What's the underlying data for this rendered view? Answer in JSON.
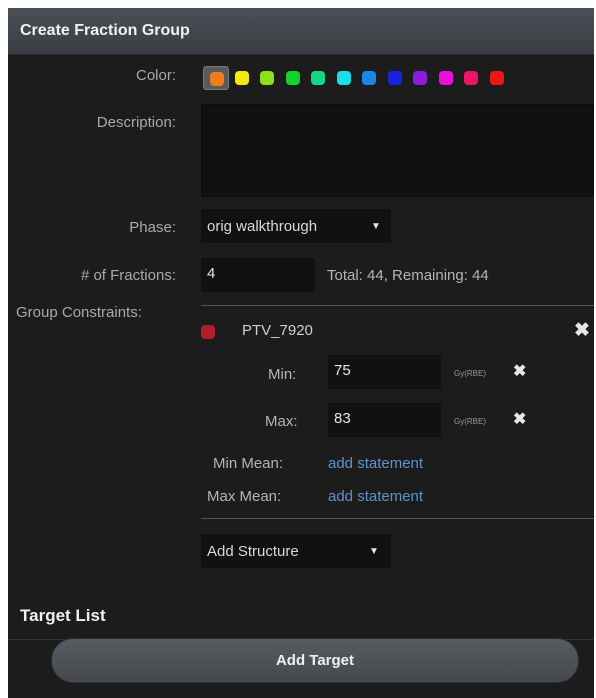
{
  "header": {
    "title": "Create Fraction Group"
  },
  "labels": {
    "color": "Color:",
    "description": "Description:",
    "phase": "Phase:",
    "fractions": "# of Fractions:",
    "group_constraints": "Group Constraints:"
  },
  "colors": [
    "#f07c1c",
    "#f2ea0c",
    "#8ee01a",
    "#14d12c",
    "#14d887",
    "#18e0e8",
    "#1a86e8",
    "#1a22e0",
    "#8a1de0",
    "#ea12d9",
    "#ee1466",
    "#ec1818"
  ],
  "selected_color_index": 0,
  "description": {
    "value": ""
  },
  "phase": {
    "value": "orig walkthrough"
  },
  "fractions": {
    "value": "4",
    "summary": "Total: 44, Remaining: 44"
  },
  "constraint": {
    "structure": "PTV_7920",
    "structure_color": "#b0202c",
    "min_label": "Min:",
    "min_value": "75",
    "max_label": "Max:",
    "max_value": "83",
    "unit": "Gy(RBE)",
    "min_mean_label": "Min Mean:",
    "max_mean_label": "Max Mean:",
    "add_statement": "add statement"
  },
  "add_structure": {
    "label": "Add Structure"
  },
  "target_list": {
    "title": "Target List",
    "add_button": "Add Target"
  }
}
